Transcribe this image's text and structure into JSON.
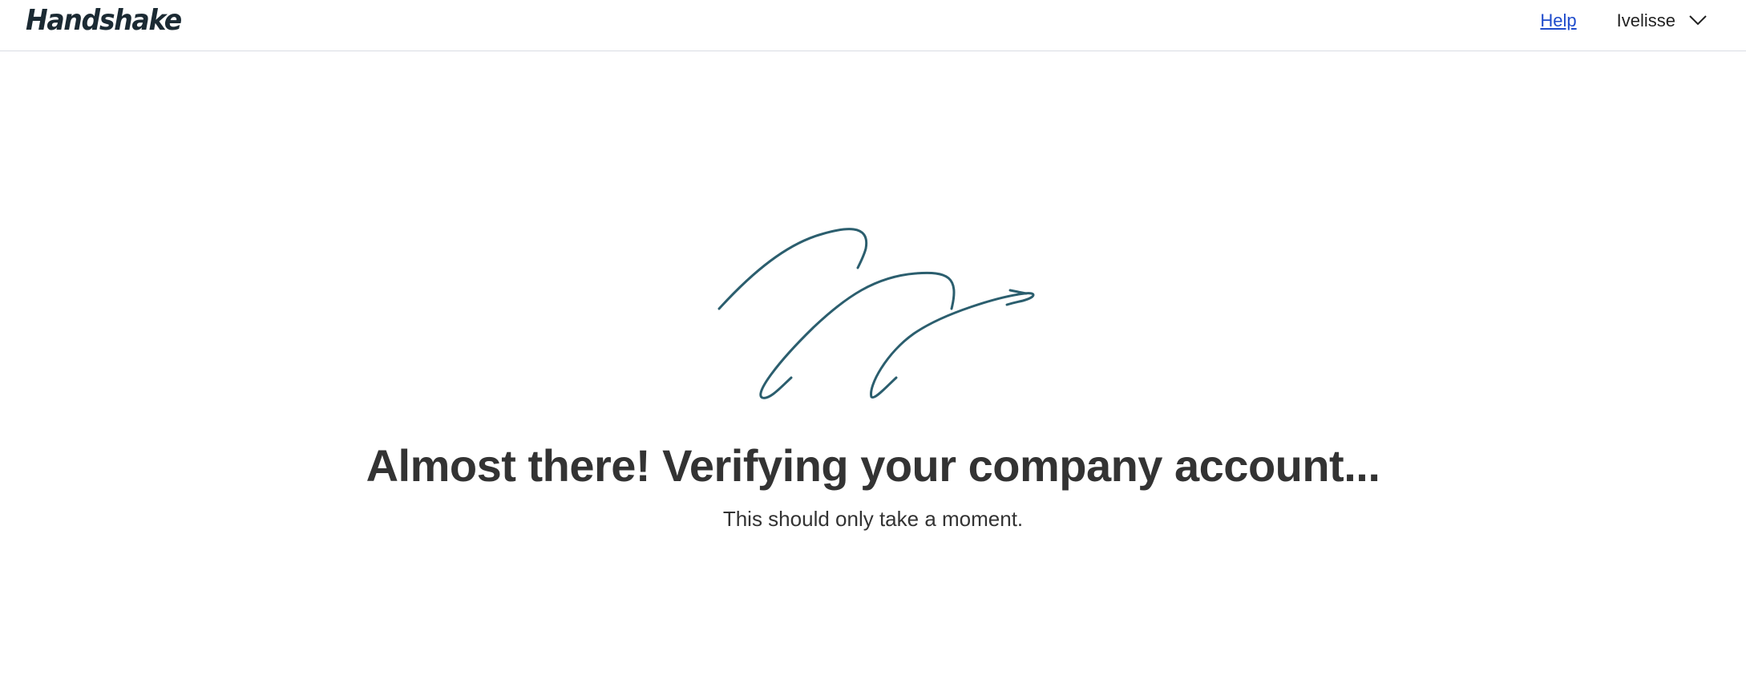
{
  "header": {
    "logo_text": "Handshake",
    "help_label": "Help",
    "user_name": "Ivelisse",
    "user_menu_icon": "chevron-down-icon"
  },
  "main": {
    "illustration_icon": "loading-squiggle-illustration",
    "headline": "Almost there! Verifying your company account...",
    "subtext": "This should only take a moment."
  },
  "colors": {
    "illustration_stroke": "#2b5e6e",
    "link": "#1f4ccc",
    "text": "#333333",
    "divider": "#d9dde3"
  }
}
